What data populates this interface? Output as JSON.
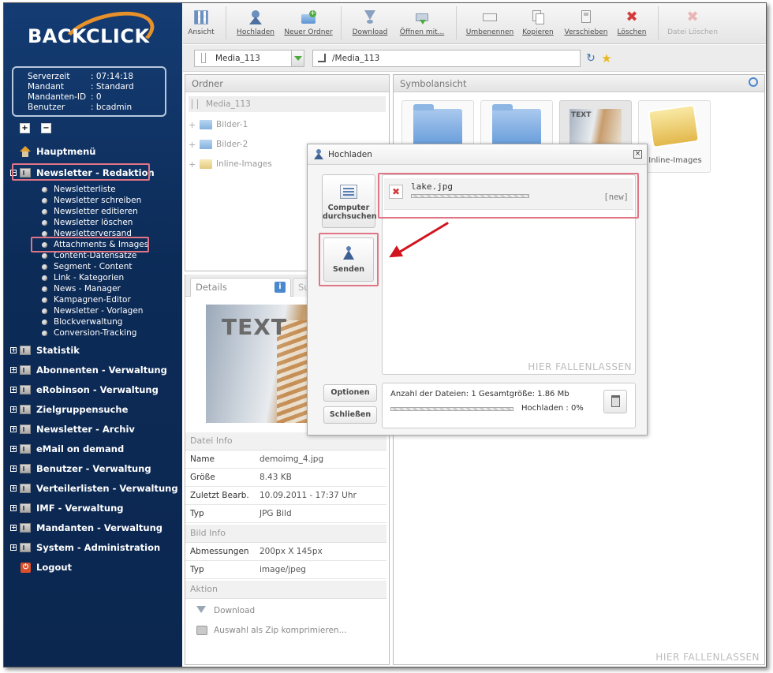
{
  "brand": {
    "logo_text": "BACKCLICK"
  },
  "serverinfo": [
    {
      "key": "Serverzeit",
      "value": ": 07:14:18"
    },
    {
      "key": "Mandant",
      "value": ": Standard"
    },
    {
      "key": "Mandanten-ID",
      "value": ": 0"
    },
    {
      "key": "Benutzer",
      "value": ": bcadmin"
    }
  ],
  "nav": {
    "home": "Hauptmenü",
    "newsletter_redaktion": "Newsletter - Redaktion",
    "sub": [
      "Newsletterliste",
      "Newsletter schreiben",
      "Newsletter editieren",
      "Newsletter löschen",
      "Newsletterversand",
      "Attachments & Images",
      "Content-Datensätze",
      "Segment - Content",
      "Link - Kategorien",
      "News - Manager",
      "Kampagnen-Editor",
      "Newsletter - Vorlagen",
      "Blockverwaltung",
      "Conversion-Tracking"
    ],
    "sections": [
      "Statistik",
      "Abonnenten - Verwaltung",
      "eRobinson - Verwaltung",
      "Zielgruppensuche",
      "Newsletter - Archiv",
      "eMail on demand",
      "Benutzer - Verwaltung",
      "Verteilerlisten - Verwaltung",
      "IMF - Verwaltung",
      "Mandanten - Verwaltung",
      "System - Administration"
    ],
    "logout": "Logout"
  },
  "toolbar": {
    "ansicht": "Ansicht",
    "hochladen": "Hochladen",
    "neuer_ordner": "Neuer Ordner",
    "download": "Download",
    "oeffnen": "Öffnen mit...",
    "umbenennen": "Umbenennen",
    "kopieren": "Kopieren",
    "verschieben": "Verschieben",
    "loeschen": "Löschen",
    "datei_loeschen": "Datei Löschen"
  },
  "pathbar": {
    "folder": "Media_113",
    "path": "/Media_113"
  },
  "ordner": {
    "title": "Ordner",
    "root": "Media_113",
    "children": [
      "Bilder-1",
      "Bilder-2",
      "Inline-Images"
    ]
  },
  "symbol": {
    "title": "Symbolansicht",
    "tile_text_label": "TEXT",
    "tile_inline_label": "Inline-Images",
    "drop_hint": "HIER FALLENLASSEN"
  },
  "details": {
    "tab_details": "Details",
    "tab_other": "Su",
    "preview_text": "TEXT",
    "datei_info": "Datei Info",
    "rows": [
      {
        "k": "Name",
        "v": "demoimg_4.jpg"
      },
      {
        "k": "Größe",
        "v": "8.43 KB"
      },
      {
        "k": "Zuletzt Bearb.",
        "v": "10.09.2011 - 17:37 Uhr"
      },
      {
        "k": "Typ",
        "v": "JPG Bild"
      }
    ],
    "bild_info": "Bild Info",
    "rows2": [
      {
        "k": "Abmessungen",
        "v": "200px X 145px"
      },
      {
        "k": "Typ",
        "v": "image/jpeg"
      }
    ],
    "aktion": "Aktion",
    "action_download": "Download",
    "action_zip": "Auswahl als Zip komprimieren..."
  },
  "dialog": {
    "title": "Hochladen",
    "browse_line1": "Computer",
    "browse_line2": "durchsuchen",
    "send": "Senden",
    "file_name": "lake.jpg",
    "file_status": "[new]",
    "file_progress": 0,
    "drop_hint": "HIER FALLENLASSEN",
    "optionen": "Optionen",
    "schliessen": "Schließen",
    "summary": "Anzahl der Dateien: 1 Gesamtgröße: 1.86 Mb",
    "upload_status": "Hochladen : 0%",
    "upload_progress": 0
  },
  "colors": {
    "sidebar": "#0c2b57",
    "highlight": "#e07585",
    "accent": "#e8912a",
    "arrow": "#d2141e"
  }
}
